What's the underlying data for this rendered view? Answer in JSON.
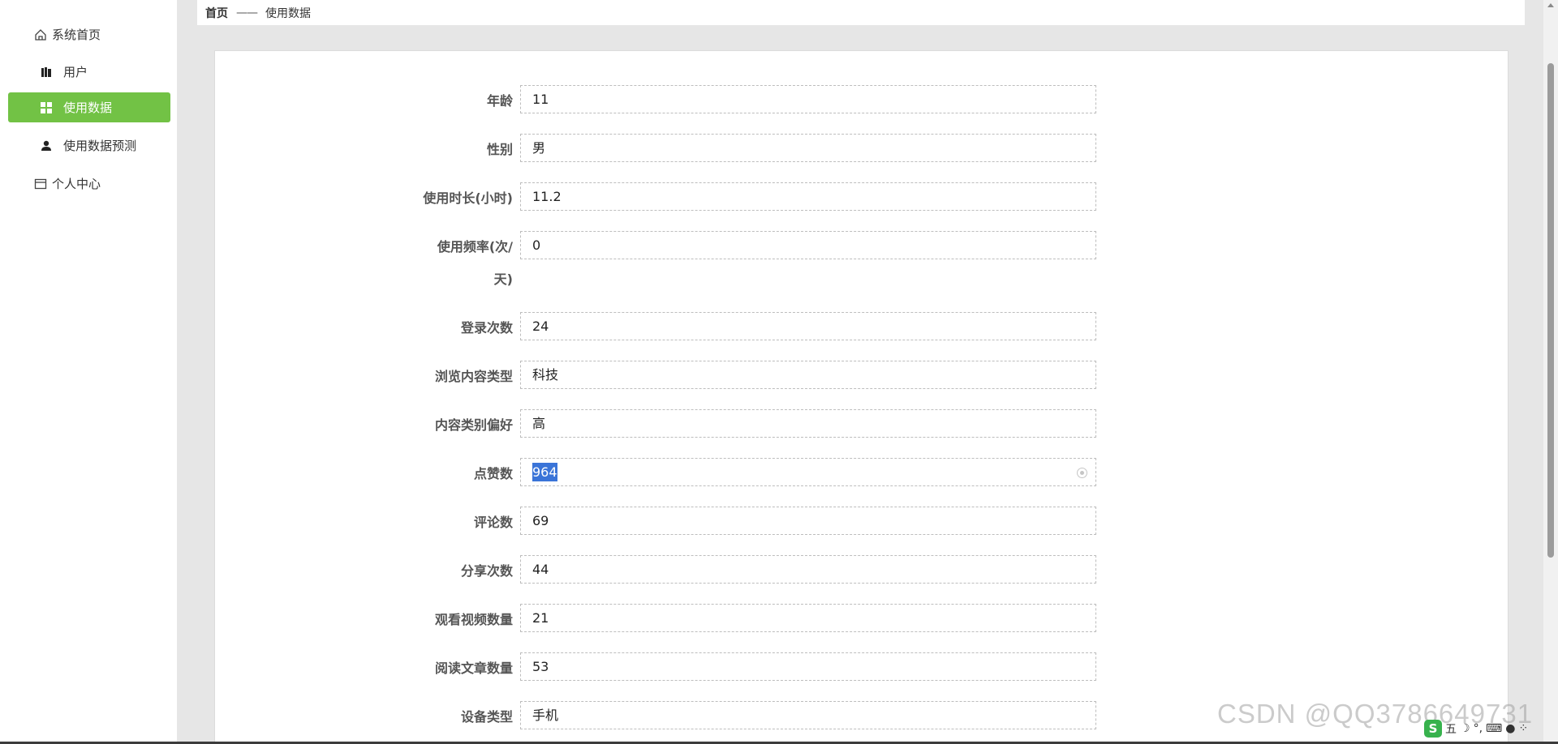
{
  "sidebar": {
    "items": [
      {
        "label": "系统首页",
        "icon": "home-icon"
      },
      {
        "label": "用户",
        "icon": "user-book-icon"
      },
      {
        "label": "使用数据",
        "icon": "grid-icon",
        "active": true
      },
      {
        "label": "使用数据预测",
        "icon": "person-icon"
      },
      {
        "label": "个人中心",
        "icon": "card-icon"
      }
    ],
    "active_color": "#72c245"
  },
  "breadcrumb": {
    "home": "首页",
    "separator": "——",
    "current": "使用数据"
  },
  "form": {
    "fields": [
      {
        "label": "年龄",
        "value": "11"
      },
      {
        "label": "性别",
        "value": "男"
      },
      {
        "label": "使用时长(小时)",
        "value": "11.2"
      },
      {
        "label": "使用频率(次/天)",
        "value": "0"
      },
      {
        "label": "登录次数",
        "value": "24"
      },
      {
        "label": "浏览内容类型",
        "value": "科技"
      },
      {
        "label": "内容类别偏好",
        "value": "高"
      },
      {
        "label": "点赞数",
        "value": "964"
      },
      {
        "label": "评论数",
        "value": "69"
      },
      {
        "label": "分享次数",
        "value": "44"
      },
      {
        "label": "观看视频数量",
        "value": "21"
      },
      {
        "label": "阅读文章数量",
        "value": "53"
      },
      {
        "label": "设备类型",
        "value": "手机"
      }
    ]
  },
  "watermark": "CSDN @QQ3786649731",
  "ime": {
    "label": "五"
  }
}
